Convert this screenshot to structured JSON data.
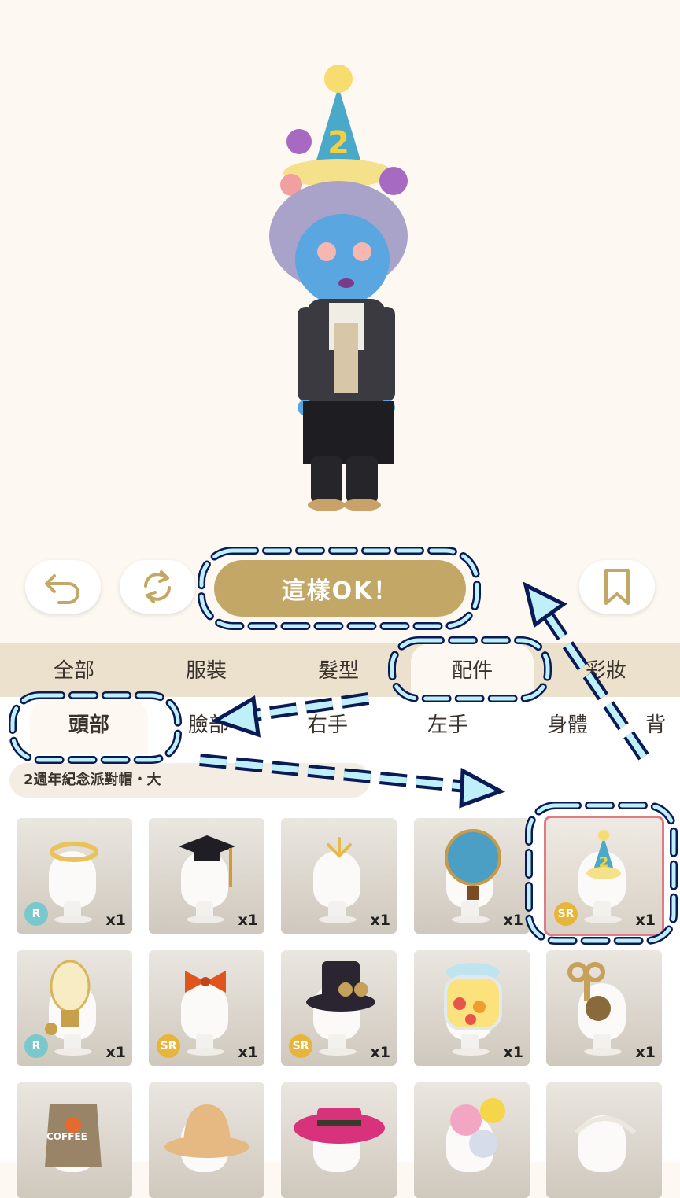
{
  "toolbar": {
    "undo_icon": "undo-arrow-icon",
    "swap_icon": "refresh-cycle-icon",
    "ok_label": "這樣OK！",
    "bookmark_icon": "bookmark-icon"
  },
  "categories": [
    {
      "label": "全部"
    },
    {
      "label": "服裝"
    },
    {
      "label": "髮型"
    },
    {
      "label": "配件",
      "active": true
    },
    {
      "label": "彩妝"
    }
  ],
  "subcategories": [
    {
      "label": "頭部",
      "active": true
    },
    {
      "label": "臉部"
    },
    {
      "label": "右手"
    },
    {
      "label": "左手"
    },
    {
      "label": "身體"
    },
    {
      "label": "背"
    }
  ],
  "selected_item_name": "2週年紀念派對帽・大",
  "items": [
    {
      "icon": "golden-halo-icon",
      "rarity": "R",
      "qty": "x1"
    },
    {
      "icon": "graduation-cap-icon",
      "rarity": "",
      "qty": "x1"
    },
    {
      "icon": "sparkle-antenna-icon",
      "rarity": "",
      "qty": "x1"
    },
    {
      "icon": "globe-icon",
      "rarity": "",
      "qty": "x1"
    },
    {
      "icon": "party-hat-2-icon",
      "rarity": "SR",
      "qty": "x1",
      "selected": true
    },
    {
      "icon": "light-bulb-icon",
      "rarity": "R",
      "qty": "x1"
    },
    {
      "icon": "red-bow-icon",
      "rarity": "SR",
      "qty": "x1"
    },
    {
      "icon": "steampunk-top-hat-icon",
      "rarity": "SR",
      "qty": "x1"
    },
    {
      "icon": "candy-jar-icon",
      "rarity": "",
      "qty": "x1"
    },
    {
      "icon": "wind-up-key-icon",
      "rarity": "",
      "qty": "x1"
    },
    {
      "icon": "coffee-bag-icon",
      "rarity": "",
      "qty": ""
    },
    {
      "icon": "bucket-hat-icon",
      "rarity": "",
      "qty": ""
    },
    {
      "icon": "pink-boater-hat-icon",
      "rarity": "",
      "qty": ""
    },
    {
      "icon": "balloons-icon",
      "rarity": "",
      "qty": ""
    },
    {
      "icon": "headband-icon",
      "rarity": "",
      "qty": ""
    }
  ],
  "coffee_text": "COFFEE",
  "colors": {
    "accent": "#c2a766",
    "annotation": "#0a1a55",
    "annotation_fill": "#bff0fa",
    "selected_border": "#e07a84"
  }
}
